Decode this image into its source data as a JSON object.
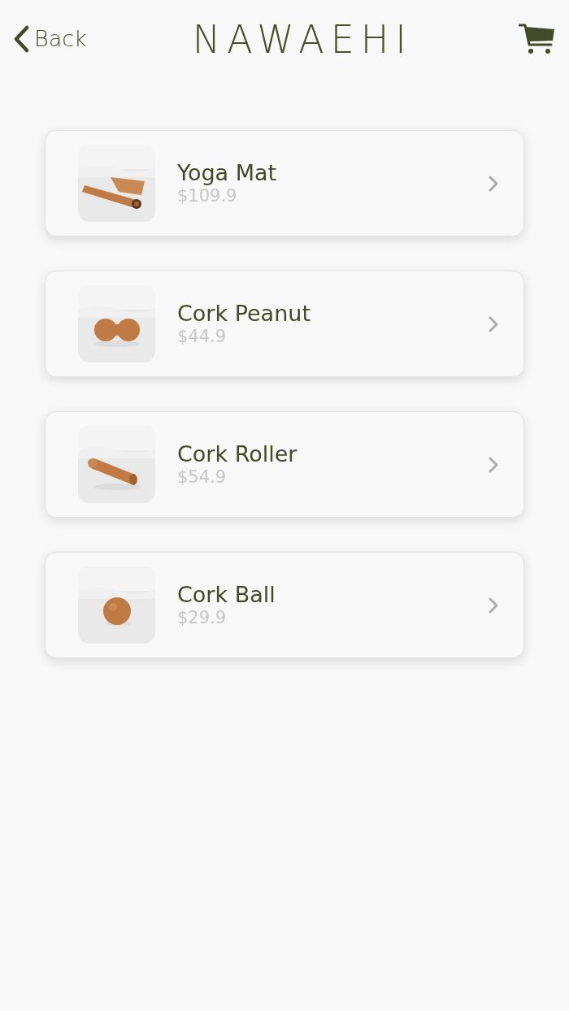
{
  "header": {
    "back_label": "Back",
    "logo": "NAWAEHI"
  },
  "products": [
    {
      "name": "Yoga Mat",
      "price": "$109.9",
      "kind": "mat"
    },
    {
      "name": "Cork Peanut",
      "price": "$44.9",
      "kind": "peanut"
    },
    {
      "name": "Cork Roller",
      "price": "$54.9",
      "kind": "roller"
    },
    {
      "name": "Cork Ball",
      "price": "$29.9",
      "kind": "ball"
    }
  ]
}
